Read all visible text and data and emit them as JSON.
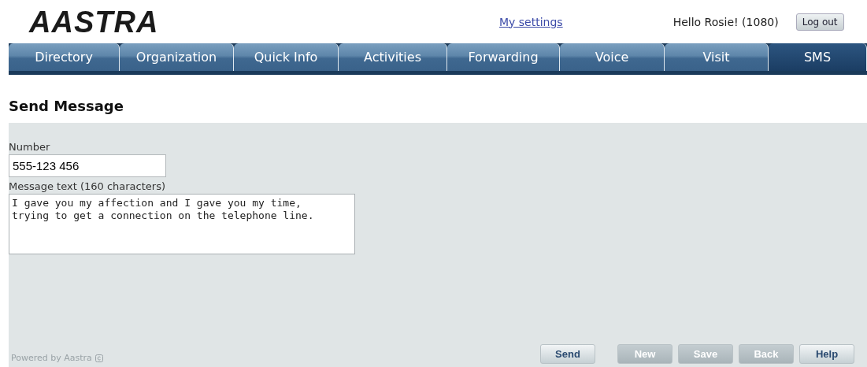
{
  "header": {
    "logo": "AASTRA",
    "settings_link": "My settings",
    "greeting": "Hello Rosie! (1080)",
    "logout_button": "Log out"
  },
  "tabs": [
    {
      "label": "Directory",
      "selected": false
    },
    {
      "label": "Organization",
      "selected": false
    },
    {
      "label": "Quick Info",
      "selected": false
    },
    {
      "label": "Activities",
      "selected": false
    },
    {
      "label": "Forwarding",
      "selected": false
    },
    {
      "label": "Voice",
      "selected": false
    },
    {
      "label": "Visit",
      "selected": false
    },
    {
      "label": "SMS",
      "selected": true
    }
  ],
  "page_title": "Send Message",
  "form": {
    "number_label": "Number",
    "number_value": "555-123 456",
    "message_label": "Message text (160 characters)",
    "message_value": "I gave you my affection and I gave you my time,\ntrying to get a connection on the telephone line."
  },
  "footer": {
    "powered_by": "Powered by Aastra"
  },
  "buttons": [
    {
      "label": "Send",
      "disabled": false
    },
    {
      "label": "New",
      "disabled": true
    },
    {
      "label": "Save",
      "disabled": true
    },
    {
      "label": "Back",
      "disabled": true
    },
    {
      "label": "Help",
      "disabled": false
    }
  ]
}
